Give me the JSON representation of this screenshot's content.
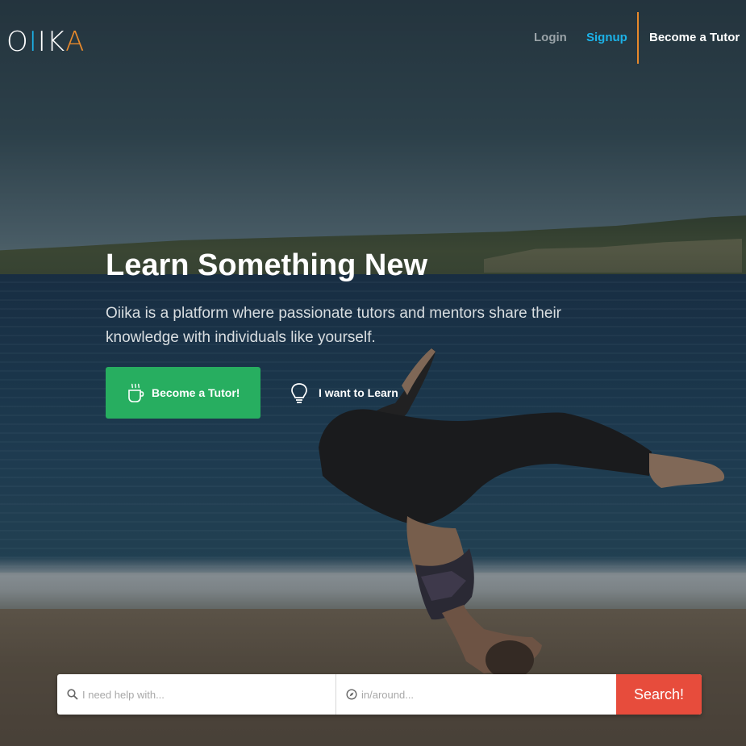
{
  "brand": {
    "logo_letters": [
      "O",
      "I",
      "I",
      "K",
      "A"
    ],
    "logo_colors": [
      "#ffffff",
      "#1cb2e8",
      "#ffffff",
      "#ffffff",
      "#e8892b"
    ]
  },
  "nav": {
    "login": "Login",
    "signup": "Signup",
    "become_tutor": "Become a Tutor"
  },
  "hero": {
    "title": "Learn Something New",
    "subtitle": "Oiika is a platform where passionate tutors and mentors share their knowledge with individuals like yourself.",
    "primary_cta": "Become a Tutor!",
    "primary_cta_icon": "coffee-cup-icon",
    "secondary_cta": "I want to Learn",
    "secondary_cta_icon": "lightbulb-icon"
  },
  "search": {
    "help_placeholder": "I need help with...",
    "help_icon": "search-icon",
    "location_placeholder": "in/around...",
    "location_icon": "compass-icon",
    "button": "Search!"
  },
  "colors": {
    "accent_blue": "#1cb2e8",
    "accent_orange": "#e8892b",
    "cta_green": "#27ae60",
    "search_red": "#e74c3c"
  }
}
